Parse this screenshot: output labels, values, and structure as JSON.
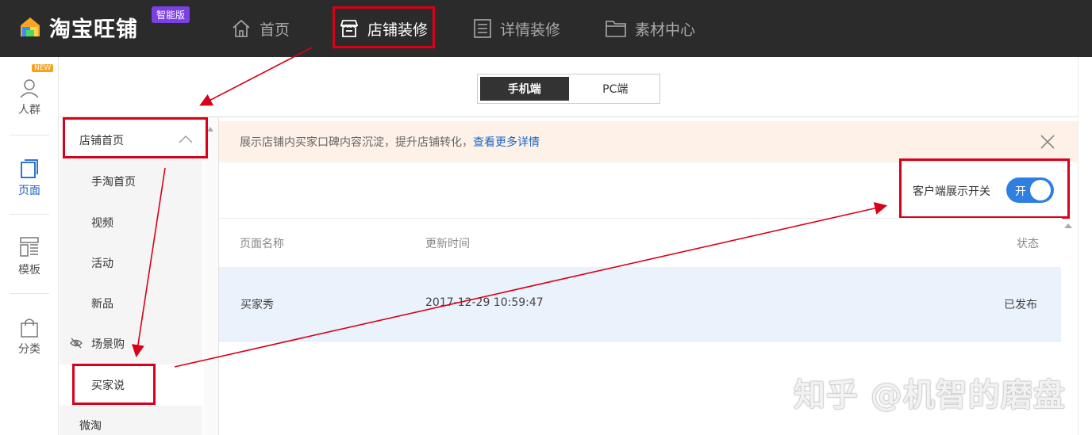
{
  "brand": {
    "name": "淘宝旺铺",
    "edition_badge": "智能版"
  },
  "topnav": {
    "items": [
      {
        "label": "首页",
        "icon": "home-icon"
      },
      {
        "label": "店铺装修",
        "icon": "store-icon"
      },
      {
        "label": "详情装修",
        "icon": "list-icon"
      },
      {
        "label": "素材中心",
        "icon": "folder-icon"
      }
    ],
    "active": "店铺装修"
  },
  "rail": {
    "items": [
      {
        "label": "人群",
        "icon": "user-icon",
        "badge": "NEW"
      },
      {
        "label": "页面",
        "icon": "page-icon"
      },
      {
        "label": "模板",
        "icon": "template-icon"
      },
      {
        "label": "分类",
        "icon": "bag-icon"
      }
    ],
    "active": "页面"
  },
  "device_switch": {
    "mobile": "手机端",
    "pc": "PC端",
    "active": "手机端"
  },
  "menu": {
    "group": "店铺首页",
    "items": [
      "手淘首页",
      "视频",
      "活动",
      "新品",
      "场景购",
      "买家说",
      "微淘"
    ],
    "selected": "买家说",
    "hidden_icon_item": "场景购"
  },
  "notice": {
    "text": "展示店铺内买家口碑内容沉淀，提升店铺转化，",
    "link": "查看更多详情"
  },
  "toggle": {
    "label": "客户端展示开关",
    "state_text": "开",
    "on": true
  },
  "table": {
    "headers": [
      "页面名称",
      "更新时间",
      "状态"
    ],
    "rows": [
      {
        "name": "买家秀",
        "updated": "2017-12-29 10:59:47",
        "status": "已发布"
      }
    ]
  },
  "watermark": "知乎 @机智的磨盘",
  "colors": {
    "topbar": "#2b2b2b",
    "accent": "#1a66c9",
    "highlight": "#d9001b",
    "toggle_on": "#2f7fe0",
    "badge": "#7b3fe4"
  }
}
